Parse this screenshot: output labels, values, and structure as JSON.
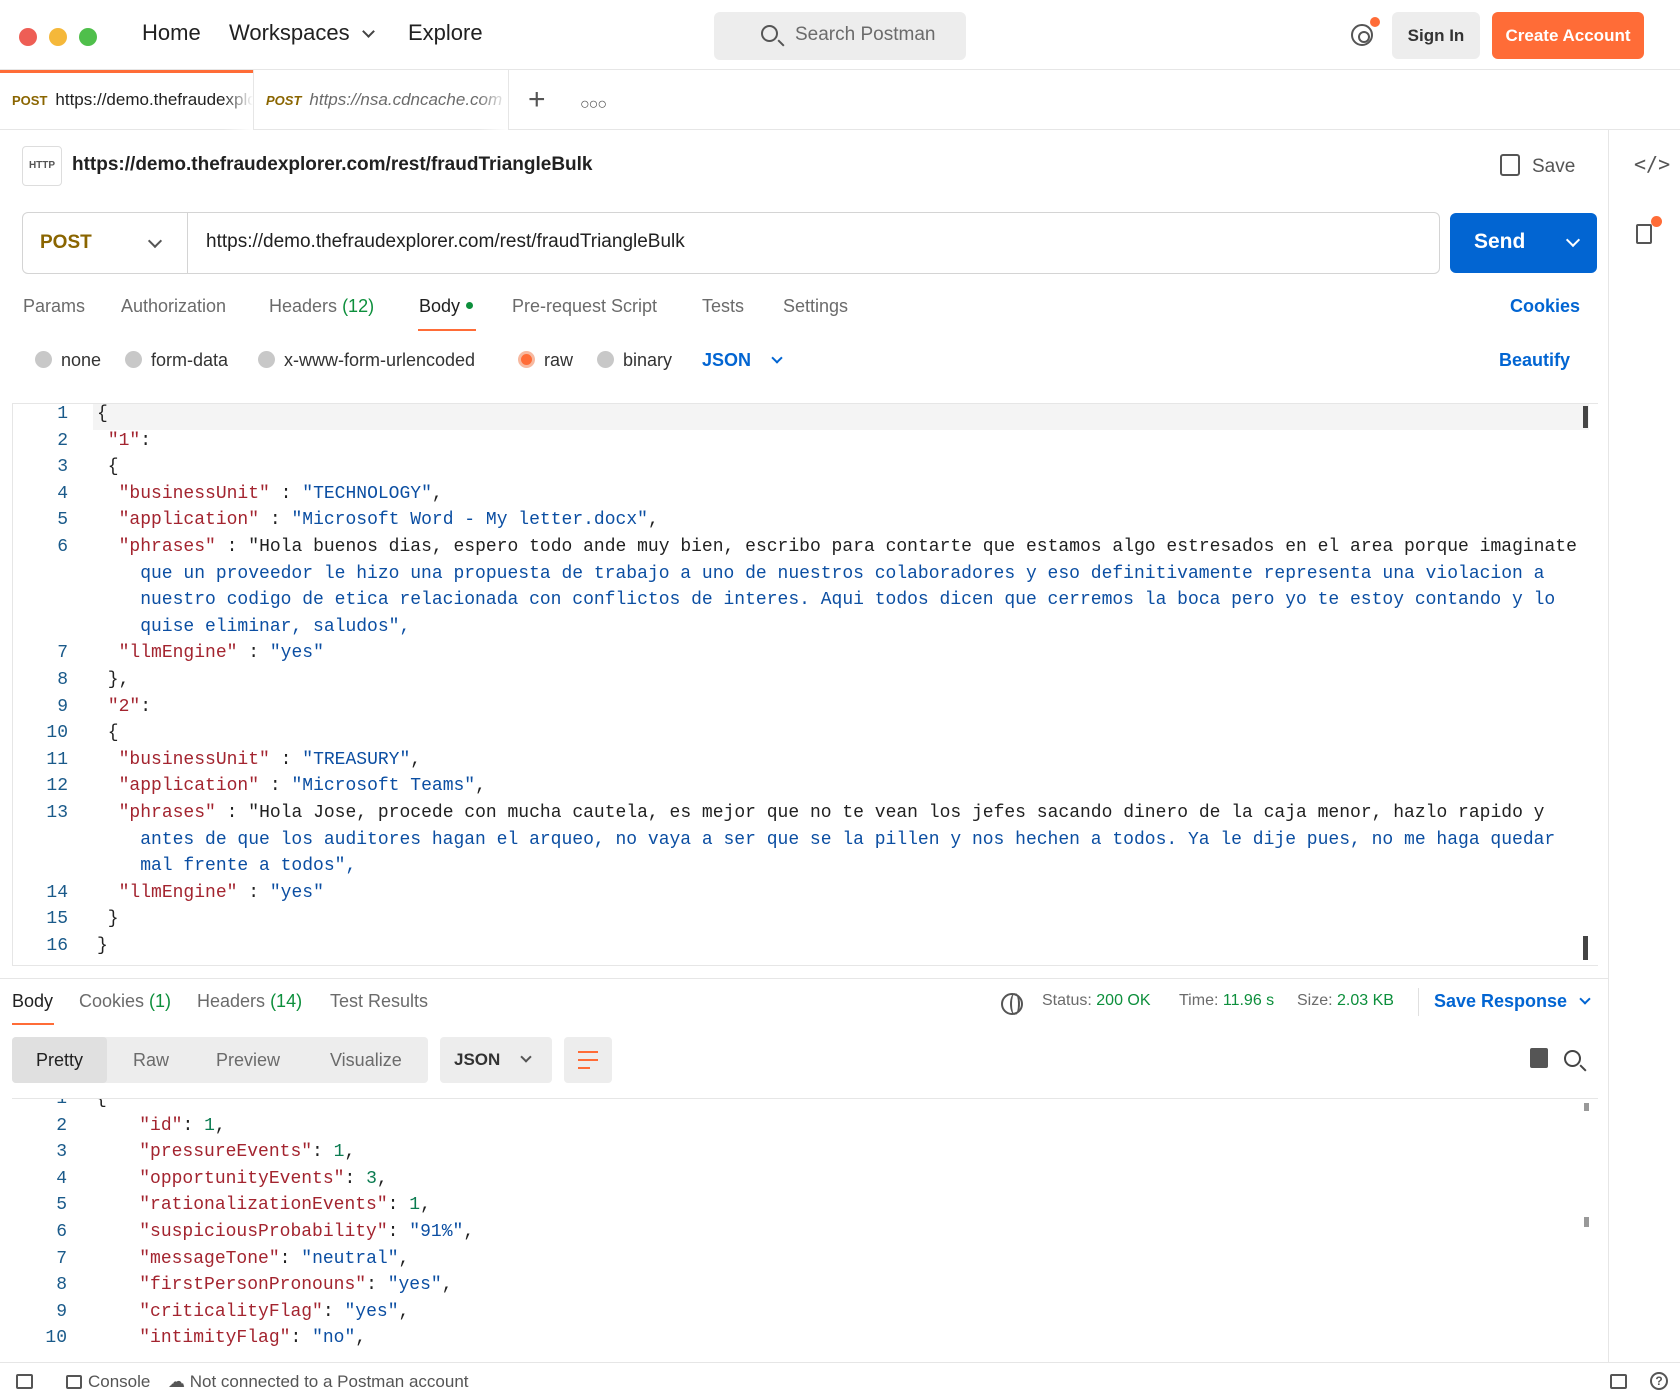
{
  "topbar": {
    "nav": {
      "home": "Home",
      "workspaces": "Workspaces",
      "explore": "Explore"
    },
    "search_placeholder": "Search Postman",
    "sign_in": "Sign In",
    "create_account": "Create Account"
  },
  "tabs": [
    {
      "method": "POST",
      "url": "https://demo.thefraudexplorer.com/rest/fraudTriangleBulk"
    },
    {
      "method": "POST",
      "url": "https://nsa.cdncache.com"
    }
  ],
  "request": {
    "title": "https://demo.thefraudexplorer.com/rest/fraudTriangleBulk",
    "http_icon": "HTTP",
    "save_label": "Save",
    "method": "POST",
    "url": "https://demo.thefraudexplorer.com/rest/fraudTriangleBulk",
    "send_label": "Send",
    "tabs": {
      "params": "Params",
      "authorization": "Authorization",
      "headers": "Headers",
      "headers_count": "(12)",
      "body": "Body",
      "prerequest": "Pre-request Script",
      "tests": "Tests",
      "settings": "Settings"
    },
    "cookies_link": "Cookies",
    "body_types": {
      "none": "none",
      "form_data": "form-data",
      "urlencoded": "x-www-form-urlencoded",
      "raw": "raw",
      "binary": "binary"
    },
    "raw_format": "JSON",
    "beautify": "Beautify"
  },
  "request_body_lines": [
    [
      "1",
      "{"
    ],
    [
      "2",
      " \"1\":"
    ],
    [
      "3",
      " {"
    ],
    [
      "4",
      "  \"businessUnit\" : \"TECHNOLOGY\","
    ],
    [
      "5",
      "  \"application\" : \"Microsoft Word - My letter.docx\","
    ],
    [
      "6",
      "  \"phrases\" : \"Hola buenos dias, espero todo ande muy bien, escribo para contarte que estamos algo estresados en el area porque imaginate"
    ],
    [
      "",
      "    que un proveedor le hizo una propuesta de trabajo a uno de nuestros colaboradores y eso definitivamente representa una violacion a"
    ],
    [
      "",
      "    nuestro codigo de etica relacionada con conflictos de interes. Aqui todos dicen que cerremos la boca pero yo te estoy contando y lo"
    ],
    [
      "",
      "    quise eliminar, saludos\","
    ],
    [
      "7",
      "  \"llmEngine\" : \"yes\""
    ],
    [
      "8",
      " },"
    ],
    [
      "9",
      " \"2\":"
    ],
    [
      "10",
      " {"
    ],
    [
      "11",
      "  \"businessUnit\" : \"TREASURY\","
    ],
    [
      "12",
      "  \"application\" : \"Microsoft Teams\","
    ],
    [
      "13",
      "  \"phrases\" : \"Hola Jose, procede con mucha cautela, es mejor que no te vean los jefes sacando dinero de la caja menor, hazlo rapido y"
    ],
    [
      "",
      "    antes de que los auditores hagan el arqueo, no vaya a ser que se la pillen y nos hechen a todos. Ya le dije pues, no me haga quedar"
    ],
    [
      "",
      "    mal frente a todos\","
    ],
    [
      "14",
      "  \"llmEngine\" : \"yes\""
    ],
    [
      "15",
      " }"
    ],
    [
      "16",
      "}"
    ]
  ],
  "response": {
    "tabs": {
      "body": "Body",
      "cookies": "Cookies",
      "cookies_count": "(1)",
      "headers": "Headers",
      "headers_count": "(14)",
      "test_results": "Test Results"
    },
    "status_label": "Status:",
    "status_value": "200 OK",
    "time_label": "Time:",
    "time_value": "11.96 s",
    "size_label": "Size:",
    "size_value": "2.03 KB",
    "save_response": "Save Response",
    "views": {
      "pretty": "Pretty",
      "raw": "Raw",
      "preview": "Preview",
      "visualize": "Visualize"
    },
    "format": "JSON"
  },
  "response_body_lines": [
    [
      "1",
      "{"
    ],
    [
      "2",
      "    \"id\": 1,"
    ],
    [
      "3",
      "    \"pressureEvents\": 1,"
    ],
    [
      "4",
      "    \"opportunityEvents\": 3,"
    ],
    [
      "5",
      "    \"rationalizationEvents\": 1,"
    ],
    [
      "6",
      "    \"suspiciousProbability\": \"91%\","
    ],
    [
      "7",
      "    \"messageTone\": \"neutral\","
    ],
    [
      "8",
      "    \"firstPersonPronouns\": \"yes\","
    ],
    [
      "9",
      "    \"criticalityFlag\": \"yes\","
    ],
    [
      "10",
      "    \"intimityFlag\": \"no\","
    ]
  ],
  "footer": {
    "console": "Console",
    "connection": "Not connected to a Postman account"
  },
  "colors": {
    "accent": "#ff6c37",
    "primary": "#0265d2",
    "success": "#0d8f3c"
  }
}
